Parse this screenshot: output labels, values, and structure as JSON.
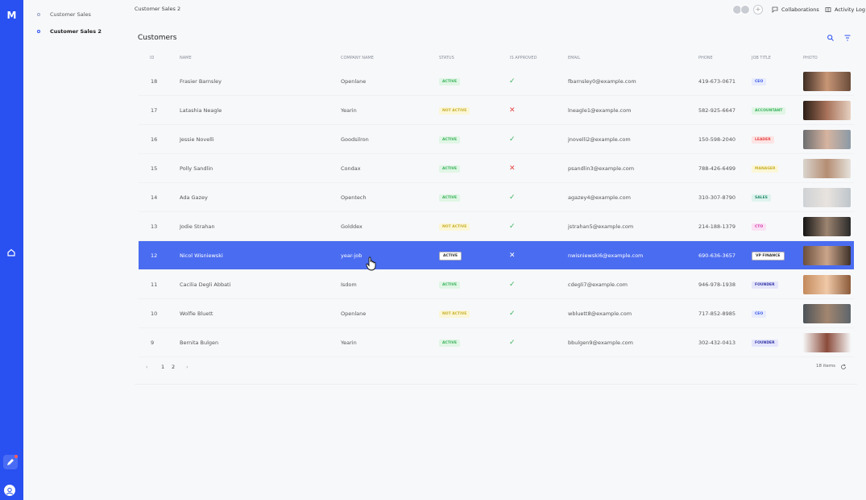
{
  "app": {
    "logo": "M",
    "title": "Customer Sales 2"
  },
  "sidebar": {
    "items": [
      {
        "label": "Customer Sales",
        "active": false
      },
      {
        "label": "Customer Sales 2",
        "active": true
      }
    ]
  },
  "topbar": {
    "collaborations": "Collaborations",
    "activity_log": "Activity Log",
    "add": "+"
  },
  "panel": {
    "title": "Customers"
  },
  "table": {
    "columns": [
      "ID",
      "NAME",
      "COMPANY NAME",
      "STATUS",
      "IS APPROVED",
      "EMAIL",
      "PHONE",
      "JOB TITLE",
      "PHOTO"
    ],
    "rows": [
      {
        "id": "18",
        "name": "Frasier Barnsley",
        "company": "Openlane",
        "status": "ACTIVE",
        "approved": "✓",
        "email": "fbarnsley0@example.com",
        "phone": "419-673-0671",
        "job": "CEO"
      },
      {
        "id": "17",
        "name": "Latashia Neagle",
        "company": "Yearin",
        "status": "NOT ACTIVE",
        "approved": "✕",
        "email": "lneagle1@example.com",
        "phone": "582-925-6647",
        "job": "ACCOUNTANT"
      },
      {
        "id": "16",
        "name": "Jessie Novelli",
        "company": "Goodsilron",
        "status": "ACTIVE",
        "approved": "✓",
        "email": "jnovelli2@example.com",
        "phone": "150-598-2040",
        "job": "LEADER"
      },
      {
        "id": "15",
        "name": "Polly Sandlin",
        "company": "Condax",
        "status": "ACTIVE",
        "approved": "✕",
        "email": "psandlin3@example.com",
        "phone": "788-426-6499",
        "job": "MANAGER"
      },
      {
        "id": "14",
        "name": "Ada Gazey",
        "company": "Opentech",
        "status": "ACTIVE",
        "approved": "✓",
        "email": "agazey4@example.com",
        "phone": "310-307-8790",
        "job": "SALES"
      },
      {
        "id": "13",
        "name": "Jodie Strahan",
        "company": "Golddex",
        "status": "NOT ACTIVE",
        "approved": "✓",
        "email": "jstrahan5@example.com",
        "phone": "214-188-1379",
        "job": "CTO"
      },
      {
        "id": "12",
        "name": "Nicol Wisniewski",
        "company": "year-job",
        "status": "ACTIVE",
        "approved": "✕",
        "email": "nwisniewski6@example.com",
        "phone": "690-636-3657",
        "job": "VP FINANCE"
      },
      {
        "id": "11",
        "name": "Cacilia Degli Abbati",
        "company": "Isdom",
        "status": "ACTIVE",
        "approved": "✓",
        "email": "cdegli7@example.com",
        "phone": "946-978-1938",
        "job": "FOUNDER"
      },
      {
        "id": "10",
        "name": "Wolfie Bluett",
        "company": "Openlane",
        "status": "NOT ACTIVE",
        "approved": "✓",
        "email": "wbluett8@example.com",
        "phone": "717-852-8985",
        "job": "CEO"
      },
      {
        "id": "9",
        "name": "Bernita Bulgen",
        "company": "Yearin",
        "status": "ACTIVE",
        "approved": "✓",
        "email": "bbulgen9@example.com",
        "phone": "302-432-0413",
        "job": "FOUNDER"
      }
    ]
  },
  "pagination": {
    "prev": "‹",
    "page1": "1",
    "page2": "2",
    "next": "›",
    "items": "18 items"
  },
  "colors": {
    "accent": "#2950f0",
    "selected_row": "#4a6cf0",
    "active": "#3bb35c",
    "not_active": "#c9b12e",
    "reject": "#e84545"
  }
}
